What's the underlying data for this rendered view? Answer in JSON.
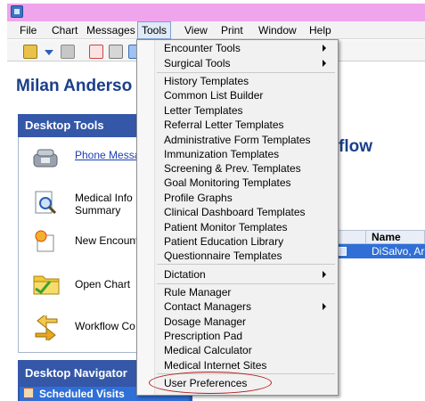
{
  "menubar": {
    "items": [
      "File",
      "Chart",
      "Messages",
      "Tools",
      "View",
      "Print",
      "Window",
      "Help"
    ],
    "active": "Tools"
  },
  "patient": {
    "name": "Milan Anderso"
  },
  "desktop_tools": {
    "title": "Desktop Tools",
    "items": [
      {
        "label": "Phone Messa",
        "icon": "phone-icon",
        "link": true
      },
      {
        "label": "Medical Info",
        "label2": "Summary",
        "icon": "magnifier-document-icon"
      },
      {
        "label": "New Encount",
        "icon": "new-encounter-icon"
      },
      {
        "label": "Open Chart",
        "icon": "folder-icon"
      },
      {
        "label": "Workflow Co",
        "icon": "workflow-arrows-icon"
      }
    ]
  },
  "workflow": {
    "title": "flow"
  },
  "grid": {
    "column": "Name",
    "row_value": "DiSalvo, Ari"
  },
  "navigator": {
    "title": "Desktop Navigator",
    "item": "Scheduled Visits"
  },
  "tools_menu": {
    "groups": [
      [
        {
          "label": "Encounter Tools",
          "submenu": true
        },
        {
          "label": "Surgical Tools",
          "submenu": true
        }
      ],
      [
        {
          "label": "History Templates"
        },
        {
          "label": "Common List Builder"
        },
        {
          "label": "Letter Templates"
        },
        {
          "label": "Referral Letter Templates"
        },
        {
          "label": "Administrative Form Templates"
        },
        {
          "label": "Immunization Templates"
        },
        {
          "label": "Screening & Prev. Templates"
        },
        {
          "label": "Goal Monitoring Templates"
        },
        {
          "label": "Profile Graphs"
        },
        {
          "label": "Clinical Dashboard Templates"
        },
        {
          "label": "Patient Monitor Templates"
        },
        {
          "label": "Patient Education Library"
        },
        {
          "label": "Questionnaire Templates"
        }
      ],
      [
        {
          "label": "Dictation",
          "submenu": true
        }
      ],
      [
        {
          "label": "Rule Manager"
        },
        {
          "label": "Contact Managers",
          "submenu": true
        },
        {
          "label": "Dosage Manager"
        },
        {
          "label": "Prescription Pad"
        },
        {
          "label": "Medical Calculator"
        },
        {
          "label": "Medical Internet Sites"
        }
      ],
      [
        {
          "label": "User Preferences",
          "highlighted": true
        }
      ]
    ]
  },
  "colors": {
    "title_bar": "#f0a4ec",
    "header_blue": "#3457a8",
    "patient_name": "#1a3f8a",
    "selection_blue": "#2f6fd6",
    "highlight_ellipse": "#b31c1c"
  }
}
